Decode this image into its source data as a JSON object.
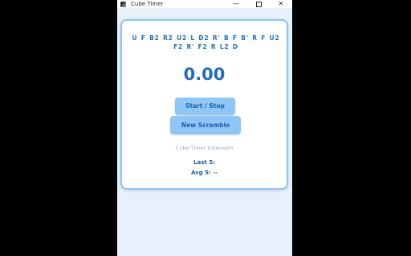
{
  "window": {
    "title": "Cube Timer",
    "minimize_glyph": "—",
    "close_glyph": "✕",
    "icons": {
      "app": "cube-app-icon",
      "minimize": "minimize-icon",
      "maximize": "maximize-icon",
      "close": "close-icon"
    }
  },
  "timer": {
    "scramble": "U F B2 R2 U2 L D2 R' B F B' R F U2 F2 R' F2 R L2 D",
    "time": "0.00",
    "start_stop_label": "Start / Stop",
    "new_scramble_label": "New Scramble",
    "footer_label": "Cube Timer Extension",
    "last5_label": "Last 5:",
    "avg5_label": "Avg 5: --"
  },
  "colors": {
    "accent": "#1f6cc0",
    "button_bg": "#8ec6f6",
    "card_border": "#8fc4f1",
    "window_bg": "#e6f1fc"
  }
}
